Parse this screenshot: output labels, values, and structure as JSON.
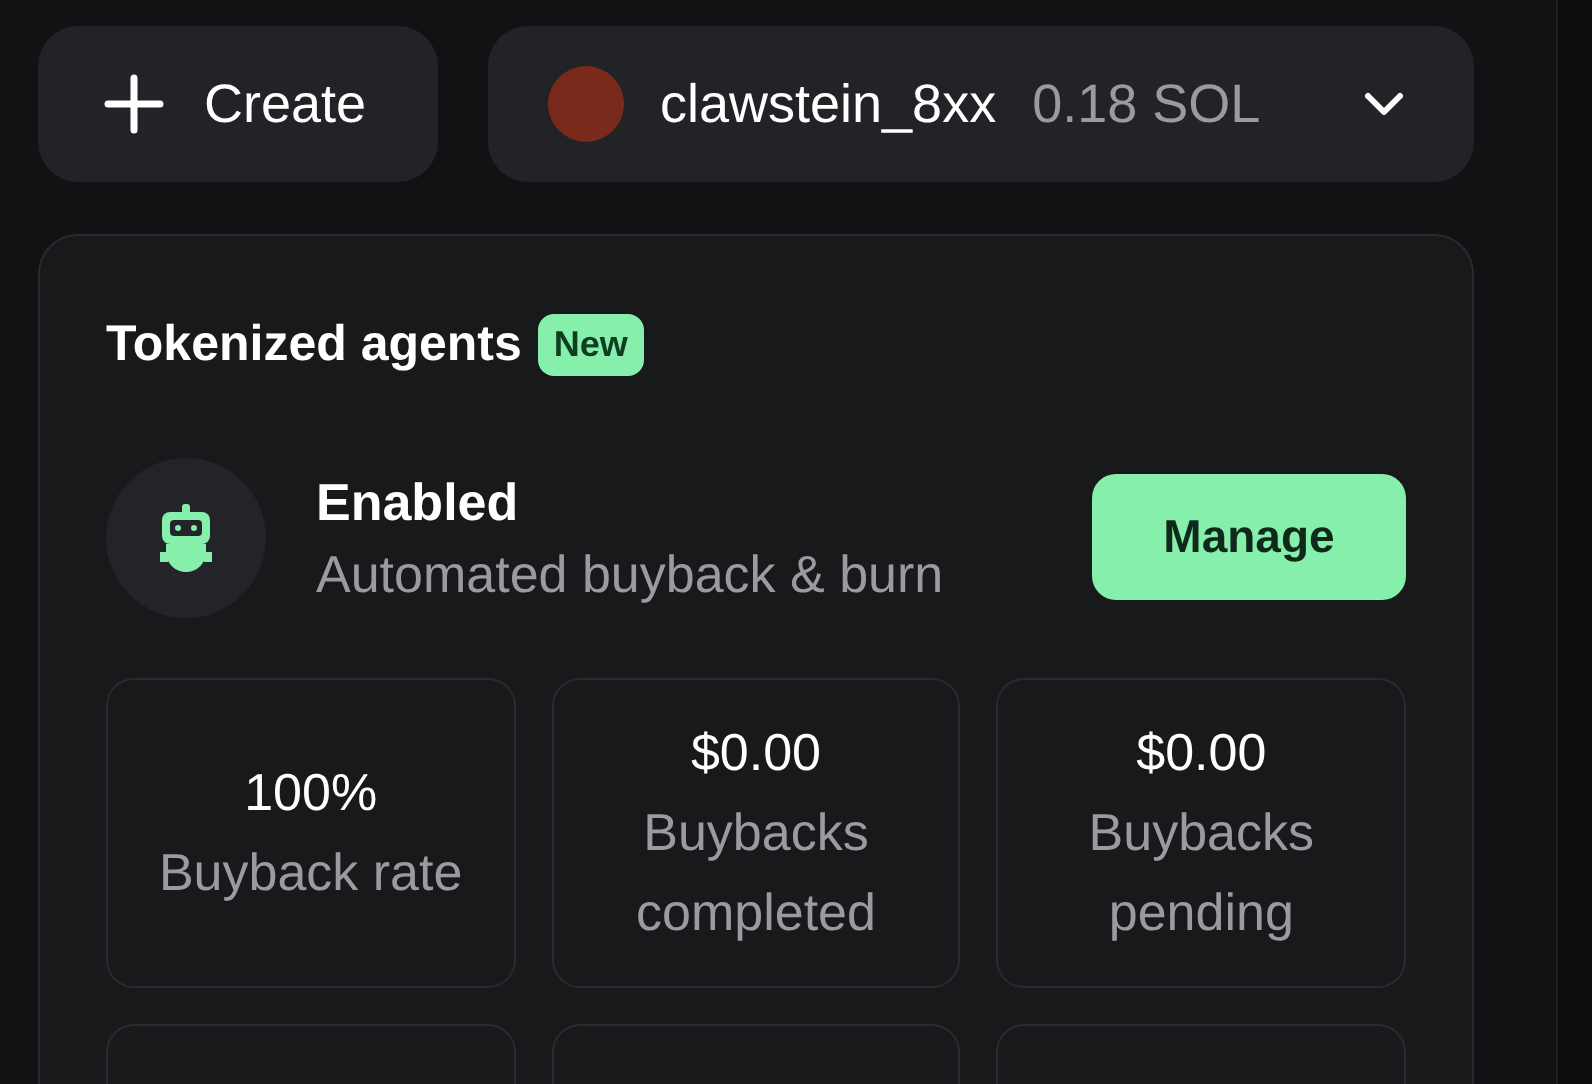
{
  "header": {
    "create_button": {
      "label": "Create"
    },
    "account": {
      "name": "clawstein_8xx",
      "balance": "0.18 SOL"
    }
  },
  "card": {
    "title": "Tokenized agents",
    "badge": "New",
    "agent": {
      "status": "Enabled",
      "description": "Automated buyback & burn",
      "button": "Manage"
    },
    "stats": [
      {
        "value": "100%",
        "label": "Buyback rate"
      },
      {
        "value": "$0.00",
        "label": "Buybacks completed"
      },
      {
        "value": "$0.00",
        "label": "Buybacks pending"
      }
    ]
  }
}
